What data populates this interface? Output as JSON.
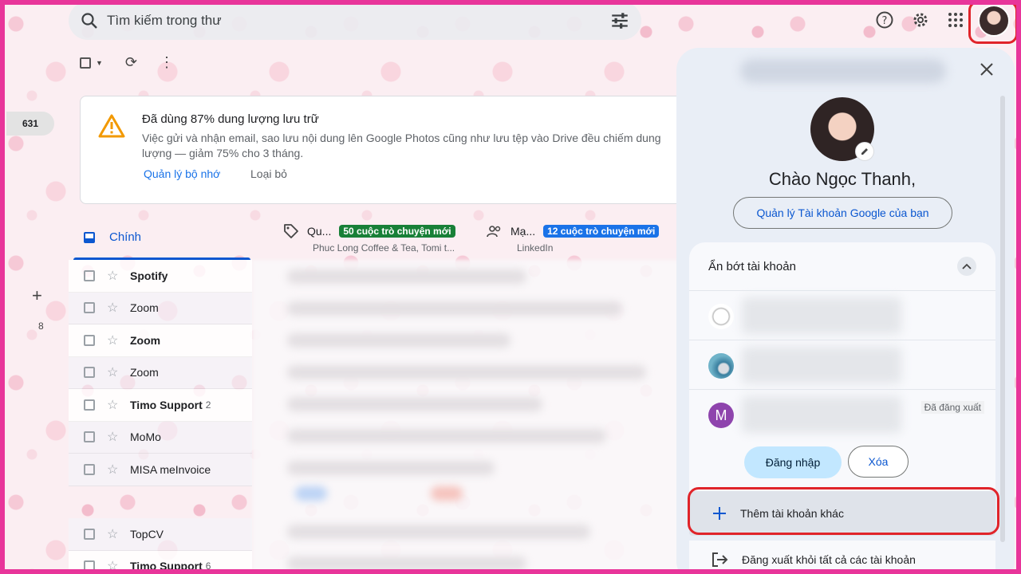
{
  "search": {
    "placeholder": "Tìm kiếm trong thư"
  },
  "rail": {
    "inbox_count": "631",
    "other_count": "8"
  },
  "storage": {
    "title": "Đã dùng 87% dung lượng lưu trữ",
    "desc": "Việc gửi và nhận email, sao lưu nội dung lên Google Photos cũng như lưu tệp vào Drive đều chiếm dung lượng — giảm 75% cho 3 tháng.",
    "link_manage": "Quản lý bộ nhớ",
    "link_dismiss": "Loại bỏ"
  },
  "tabs": {
    "primary": "Chính",
    "promotions": {
      "title": "Qu...",
      "badge": "50 cuộc trò chuyện mới",
      "sub": "Phuc Long Coffee & Tea, Tomi t..."
    },
    "social": {
      "title": "Mạ...",
      "badge": "12 cuộc trò chuyện mới",
      "sub": "LinkedIn"
    }
  },
  "mails": [
    {
      "sender": "Spotify",
      "count": "",
      "unread": true
    },
    {
      "sender": "Zoom",
      "count": "",
      "unread": false
    },
    {
      "sender": "Zoom",
      "count": "",
      "unread": true
    },
    {
      "sender": "Zoom",
      "count": "",
      "unread": false
    },
    {
      "sender": "Timo Support",
      "count": "2",
      "unread": true
    },
    {
      "sender": "MoMo",
      "count": "",
      "unread": false
    },
    {
      "sender": "MISA meInvoice",
      "count": "",
      "unread": false
    },
    {
      "sender": "",
      "count": "",
      "unread": false
    },
    {
      "sender": "TopCV",
      "count": "",
      "unread": false
    },
    {
      "sender": "Timo Support",
      "count": "6",
      "unread": true
    }
  ],
  "account": {
    "greeting": "Chào Ngọc Thanh,",
    "manage": "Quản lý Tài khoản Google của bạn",
    "hide_accounts": "Ẩn bớt tài khoản",
    "signed_out": "Đã đăng xuất",
    "avatar_letter": "M",
    "sign_in": "Đăng nhập",
    "remove": "Xóa",
    "add_account": "Thêm tài khoản khác",
    "sign_out_all": "Đăng xuất khỏi tất cả các tài khoản"
  },
  "colors": {
    "frame": "#e8359a",
    "highlight": "#e0242a",
    "accent": "#0b57d0",
    "promo_badge": "#188038",
    "social_badge": "#1a73e8"
  }
}
